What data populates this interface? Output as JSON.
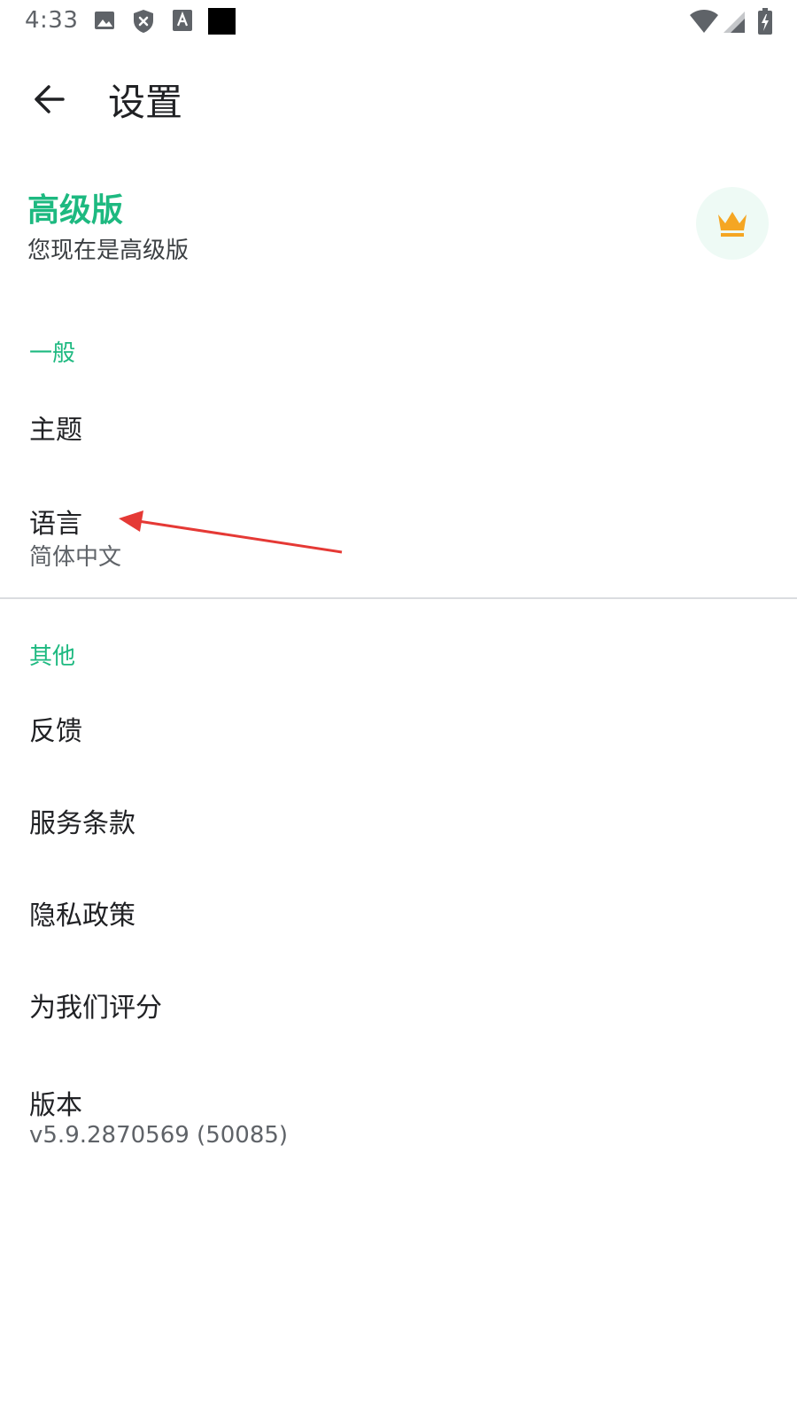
{
  "status_bar": {
    "time": "4:33",
    "icons": [
      "image-icon",
      "shield-icon",
      "text-a-icon",
      "black-square-icon",
      "wifi-icon",
      "signal-icon",
      "battery-charging-icon"
    ]
  },
  "app_bar": {
    "title": "设置"
  },
  "premium": {
    "title": "高级版",
    "subtitle": "您现在是高级版",
    "icon": "crown-icon"
  },
  "sections": {
    "general": {
      "header": "一般",
      "theme_label": "主题",
      "language_label": "语言",
      "language_value": "简体中文"
    },
    "other": {
      "header": "其他",
      "feedback_label": "反馈",
      "terms_label": "服务条款",
      "privacy_label": "隐私政策",
      "rate_label": "为我们评分",
      "version_label": "版本",
      "version_value": "v5.9.2870569 (50085)"
    }
  },
  "colors": {
    "accent": "#1db980",
    "crown": "#f5a623",
    "annotation": "#e53935"
  }
}
